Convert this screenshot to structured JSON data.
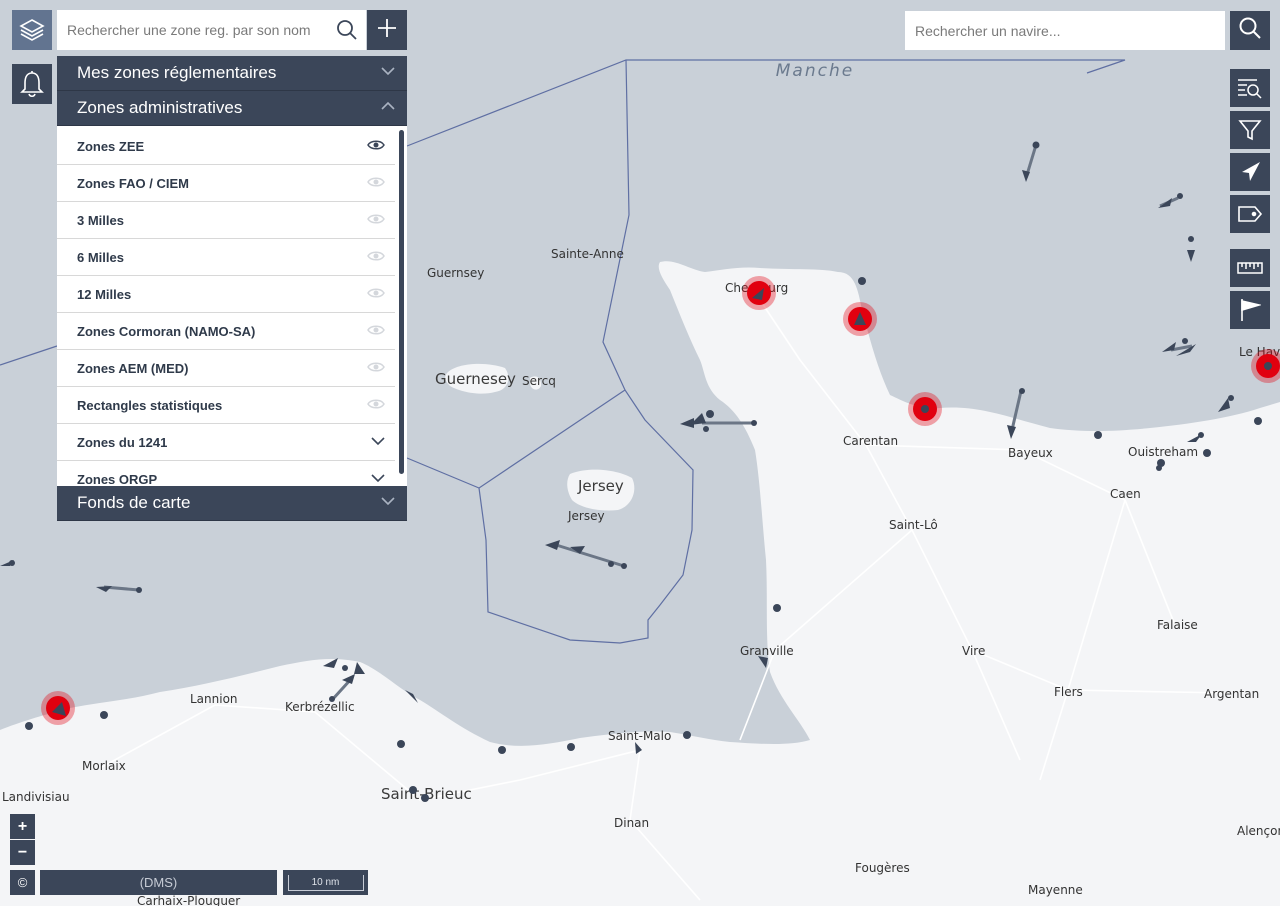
{
  "map": {
    "sea_label": "Manche",
    "places": [
      {
        "name": "Guernsey"
      },
      {
        "name": "Sainte-Anne"
      },
      {
        "name": "Guernesey"
      },
      {
        "name": "Sercq"
      },
      {
        "name": "Cherbourg"
      },
      {
        "name": "Jersey"
      },
      {
        "name": "Jersey"
      },
      {
        "name": "Carentan"
      },
      {
        "name": "Bayeux"
      },
      {
        "name": "Ouistreham"
      },
      {
        "name": "Caen"
      },
      {
        "name": "Le Havre"
      },
      {
        "name": "Saint-Lô"
      },
      {
        "name": "Falaise"
      },
      {
        "name": "Granville"
      },
      {
        "name": "Vire"
      },
      {
        "name": "Flers"
      },
      {
        "name": "Argentan"
      },
      {
        "name": "Lannion"
      },
      {
        "name": "Kerbrézellic"
      },
      {
        "name": "Morlaix"
      },
      {
        "name": "Landivisiau"
      },
      {
        "name": "Saint-Malo"
      },
      {
        "name": "Saint-Brieuc"
      },
      {
        "name": "Dinan"
      },
      {
        "name": "Fougères"
      },
      {
        "name": "Alençon"
      },
      {
        "name": "Mayenne"
      },
      {
        "name": "Carhaix-Plouguer"
      }
    ]
  },
  "zone_search": {
    "placeholder": "Rechercher une zone reg. par son nom"
  },
  "vessel_search": {
    "placeholder": "Rechercher un navire..."
  },
  "panel": {
    "my_zones_label": "Mes zones réglementaires",
    "admin_zones_label": "Zones administratives",
    "basemaps_label": "Fonds de carte",
    "zones": [
      {
        "label": "Zones ZEE",
        "control": "eye",
        "active": true
      },
      {
        "label": "Zones FAO / CIEM",
        "control": "eye",
        "active": false
      },
      {
        "label": "3 Milles",
        "control": "eye",
        "active": false
      },
      {
        "label": "6 Milles",
        "control": "eye",
        "active": false
      },
      {
        "label": "12 Milles",
        "control": "eye",
        "active": false
      },
      {
        "label": "Zones Cormoran (NAMO-SA)",
        "control": "eye",
        "active": false
      },
      {
        "label": "Zones AEM (MED)",
        "control": "eye",
        "active": false
      },
      {
        "label": "Rectangles statistiques",
        "control": "eye",
        "active": false
      },
      {
        "label": "Zones du 1241",
        "control": "chevron",
        "active": false
      },
      {
        "label": "Zones ORGP",
        "control": "chevron",
        "active": false
      }
    ]
  },
  "controls": {
    "zoom_in": "+",
    "zoom_out": "−",
    "attribution": "©",
    "coordinates": "(DMS)",
    "scale": "10 nm"
  },
  "colors": {
    "primary": "#3b4659",
    "layers_button": "#627490",
    "alert_vessel": "#e1000f",
    "sea": "#c9d0d8",
    "land": "#f4f5f7"
  },
  "right_toolbar": [
    "vessel-list-icon",
    "filter-icon",
    "vessel-visibility-icon",
    "label-icon",
    "ruler-icon",
    "interest-point-icon"
  ]
}
